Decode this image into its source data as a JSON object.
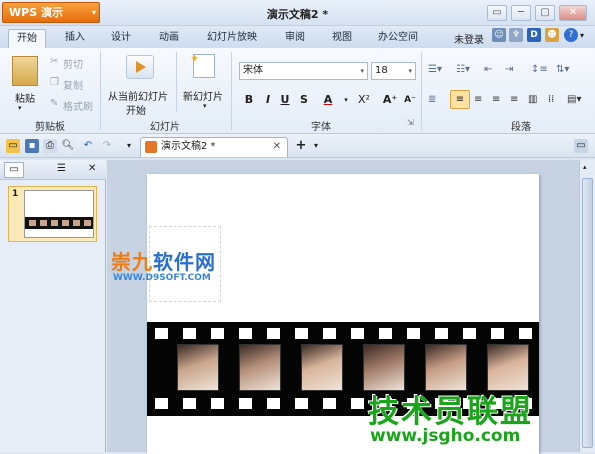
{
  "app": {
    "logo_label": "WPS 演示",
    "logo_drop": "▾",
    "title": "演示文稿2 *"
  },
  "window_buttons": [
    "▭",
    "─",
    "▢",
    "✕"
  ],
  "menu": {
    "tabs": [
      "开始",
      "插入",
      "设计",
      "动画",
      "幻灯片放映",
      "审阅",
      "视图",
      "办公空间"
    ],
    "login": "未登录",
    "help": "?"
  },
  "ribbon": {
    "clipboard": {
      "paste": "粘贴",
      "cut": "剪切",
      "copy": "复制",
      "format_painter": "格式刷",
      "group": "剪贴板"
    },
    "slides": {
      "from_current_line1": "从当前幻灯片",
      "from_current_line2": "开始",
      "new_slide": "新幻灯片",
      "group": "幻灯片"
    },
    "font": {
      "name": "宋体",
      "size": "18",
      "bold": "B",
      "italic": "I",
      "underline": "U",
      "strike": "S",
      "color": "A",
      "superscript": "X²",
      "grow": "A⁺",
      "shrink": "A⁻",
      "group": "字体",
      "launcher": "⇲"
    },
    "paragraph": {
      "group": "段落"
    }
  },
  "quick_access": {
    "doc_tab": "演示文稿2 *",
    "close": "✕",
    "add": "+"
  },
  "left_pane": {
    "slide_number": "1",
    "close": "✕"
  },
  "watermarks": {
    "site1_orange": "崇九",
    "site1_blue": "软件网",
    "site1_url": "WWW.D9SOFT.COM",
    "site2_text": "技术员联盟",
    "site2_url": "www.jsgho.com"
  },
  "colors": {
    "logo": "#e56d0c",
    "ribbon_bg": "#eef3fa",
    "film": "#050505",
    "watermark_green": "#1aa51a",
    "watermark_blue": "#2a6fd0"
  }
}
